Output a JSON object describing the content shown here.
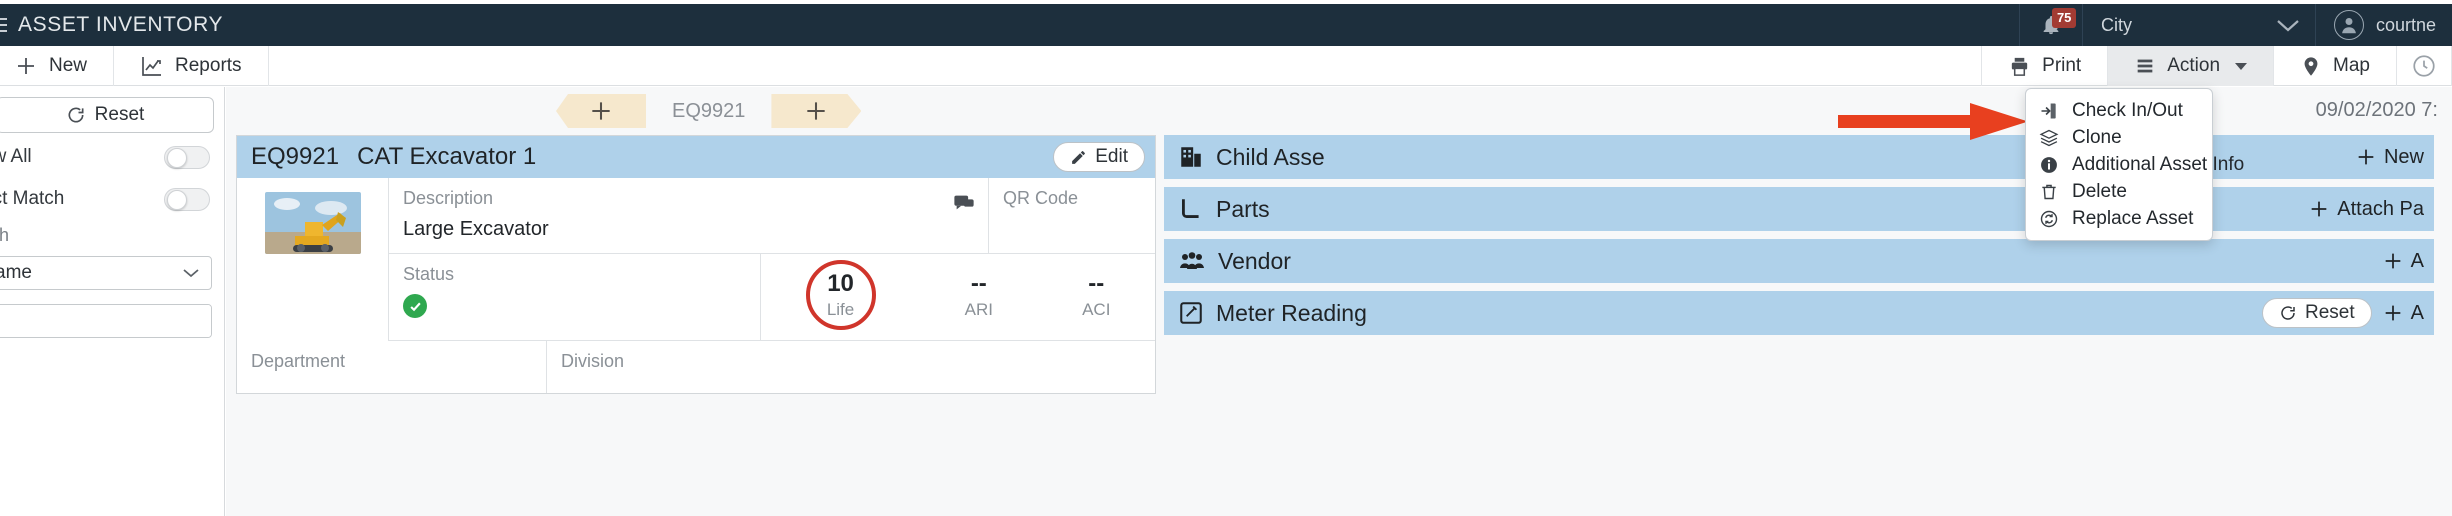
{
  "header": {
    "menu_icon": "hamburger-icon",
    "title": "ASSET INVENTORY",
    "bell_icon": "bell-icon",
    "notification_count": "75",
    "org_selector": {
      "value": "City",
      "chevron": "chevron-down-icon"
    },
    "user": {
      "avatar": "user-avatar-icon",
      "name": "courtne"
    },
    "bar_color": "#1d2f3d",
    "badge_color": "#a23b33"
  },
  "toolbar": {
    "left": [
      {
        "icon": "plus-icon",
        "label": "New"
      },
      {
        "icon": "chart-line-icon",
        "label": "Reports"
      }
    ],
    "right": [
      {
        "icon": "printer-icon",
        "label": "Print",
        "active": false
      },
      {
        "icon": "list-bars-icon",
        "label": "Action",
        "active": true,
        "caret": true
      },
      {
        "icon": "map-pin-icon",
        "label": "Map",
        "active": false
      },
      {
        "icon": "history-back-icon",
        "label": "",
        "active": false
      }
    ]
  },
  "action_menu": {
    "items": [
      {
        "icon": "check-in-out-icon",
        "label": "Check In/Out"
      },
      {
        "icon": "clone-layers-icon",
        "label": "Clone"
      },
      {
        "icon": "info-circle-icon",
        "label": "Additional Asset Info"
      },
      {
        "icon": "trash-icon",
        "label": "Delete"
      },
      {
        "icon": "replace-refresh-icon",
        "label": "Replace Asset"
      }
    ]
  },
  "annotation": {
    "type": "red-arrow",
    "color": "#e8401f",
    "points_to": "action-menu"
  },
  "sidebar": {
    "reset": {
      "icon": "refresh-icon",
      "label": "Reset"
    },
    "toggles": [
      {
        "label": "ow All",
        "on": false
      },
      {
        "label": "act Match",
        "on": false
      }
    ],
    "hint_text": "rch",
    "select": {
      "value": "ame",
      "chevron": "chevron-down-icon"
    },
    "search": {
      "value": "",
      "placeholder": "",
      "icon": "search-icon"
    }
  },
  "workspace": {
    "chips": [
      {
        "icon": "plus-icon",
        "shape": "left-notch"
      },
      {
        "label": "EQ9921"
      },
      {
        "icon": "plus-icon",
        "shape": "right-arrow"
      }
    ],
    "timestamp": "09/02/2020 7:"
  },
  "asset": {
    "id": "EQ9921",
    "name": "CAT Excavator 1",
    "edit": {
      "icon": "pencil-icon",
      "label": "Edit"
    },
    "photo_alt": "excavator-thumbnail",
    "fields": {
      "description_label": "Description",
      "description_value": "Large Excavator",
      "comment_icon": "comment-icon",
      "qr_label": "QR Code",
      "status_label": "Status",
      "status_state": "ok"
    },
    "metrics": [
      {
        "value": "10",
        "label": "Life",
        "circled": true
      },
      {
        "value": "--",
        "label": "ARI",
        "circled": false
      },
      {
        "value": "--",
        "label": "ACI",
        "circled": false
      }
    ],
    "bottom_headers": [
      "Department",
      "Division"
    ]
  },
  "panels": [
    {
      "icon": "building-icon",
      "title": "Child Asse",
      "actions": [
        {
          "type": "plain",
          "icon": "plus-icon",
          "label": "New"
        }
      ]
    },
    {
      "icon": "pipe-parts-icon",
      "title": "Parts",
      "actions": [
        {
          "type": "plain",
          "icon": "plus-icon",
          "label": "Attach Pa"
        }
      ]
    },
    {
      "icon": "vendor-people-icon",
      "title": "Vendor",
      "actions": [
        {
          "type": "plain",
          "icon": "plus-icon",
          "label": "A"
        }
      ]
    },
    {
      "icon": "meter-edit-icon",
      "title": "Meter Reading",
      "actions": [
        {
          "type": "pill",
          "icon": "refresh-icon",
          "label": "Reset"
        },
        {
          "type": "plain",
          "icon": "plus-icon",
          "label": "A"
        }
      ]
    }
  ],
  "colors": {
    "panel_header": "#afd1ea",
    "chip": "#f6e8cd",
    "status_green": "#2fa84f",
    "life_ring": "#d0352b"
  }
}
